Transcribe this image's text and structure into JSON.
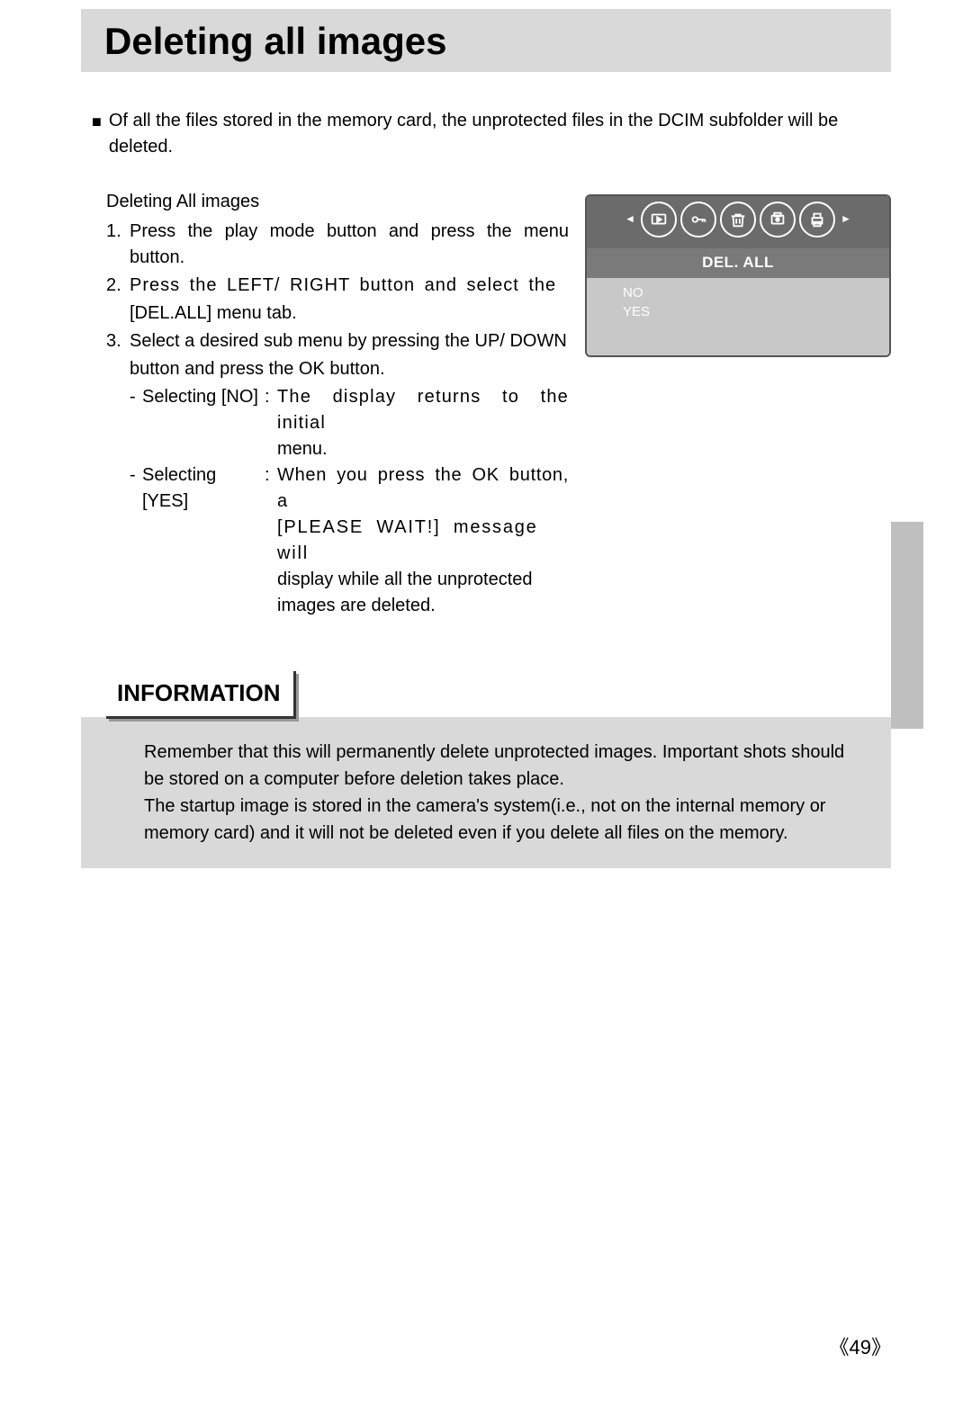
{
  "title": "Deleting all images",
  "intro": "Of all the files stored in the memory card, the unprotected files in the DCIM subfolder will be deleted.",
  "subhead": "Deleting All images",
  "steps": {
    "s1": "Press the play mode button and press the menu button.",
    "s2a": "Press the LEFT/ RIGHT button and select the",
    "s2b": "[DEL.ALL] menu tab.",
    "s3a": "Select a desired sub menu by pressing the UP/ DOWN",
    "s3b": "button and press the OK button."
  },
  "selectNoLabel": "Selecting [NO]",
  "selectNoDesc1": "The display returns to the initial",
  "selectNoDesc2": "menu.",
  "selectYesLabel": "Selecting [YES]",
  "selectYesDesc1": "When you press the OK button, a",
  "selectYesDesc2": "[PLEASE WAIT!] message will",
  "selectYesDesc3": "display while all the unprotected images are deleted.",
  "infoHead": "INFORMATION",
  "infoLine1": "Remember that this will permanently delete unprotected images. Important shots should be stored on a computer before deletion takes place.",
  "infoLine2": "The startup image is stored in the camera's system(i.e., not on the internal memory or memory card) and it will not be deleted even if you delete all files on the memory.",
  "lcd": {
    "header": "DEL. ALL",
    "opt1": "NO",
    "opt2": "YES"
  },
  "pageNum": "49"
}
